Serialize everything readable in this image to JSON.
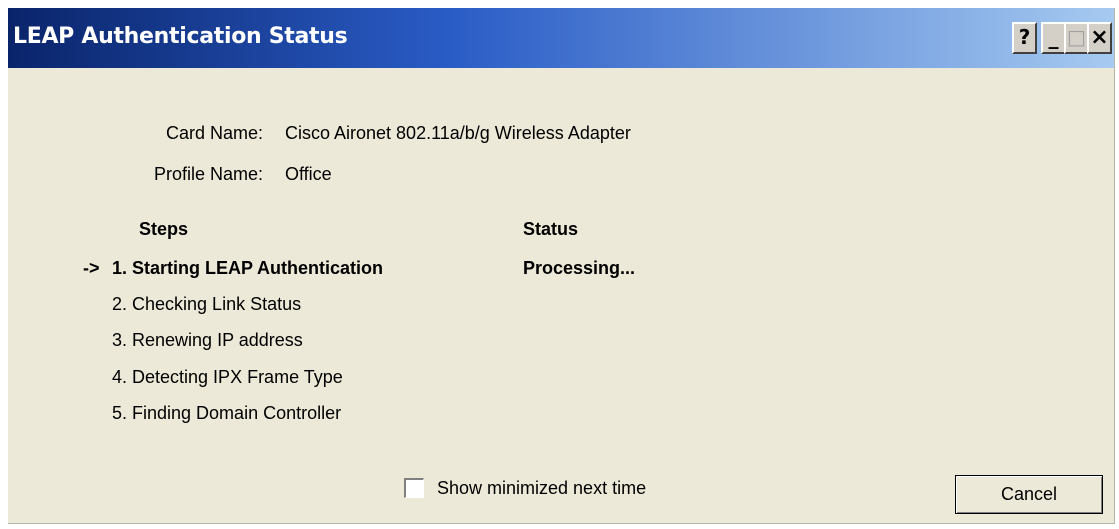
{
  "window": {
    "title": "LEAP Authentication Status",
    "help_glyph": "?",
    "minimize_glyph": "_",
    "maximize_glyph": "□",
    "close_glyph": "×"
  },
  "info": {
    "card_name_label": "Card Name:",
    "card_name_value": "Cisco Aironet 802.11a/b/g Wireless Adapter",
    "profile_name_label": "Profile Name:",
    "profile_name_value": "Office"
  },
  "table": {
    "steps_header": "Steps",
    "status_header": "Status",
    "current_marker": "->",
    "steps": [
      {
        "label": "1. Starting LEAP Authentication",
        "status": "Processing...",
        "current": true
      },
      {
        "label": "2. Checking Link Status",
        "status": ""
      },
      {
        "label": "3. Renewing IP address",
        "status": ""
      },
      {
        "label": "4. Detecting IPX Frame Type",
        "status": ""
      },
      {
        "label": "5. Finding Domain Controller",
        "status": ""
      }
    ]
  },
  "footer": {
    "show_minimized_label": "Show minimized next time",
    "show_minimized_checked": false,
    "cancel_label": "Cancel"
  }
}
